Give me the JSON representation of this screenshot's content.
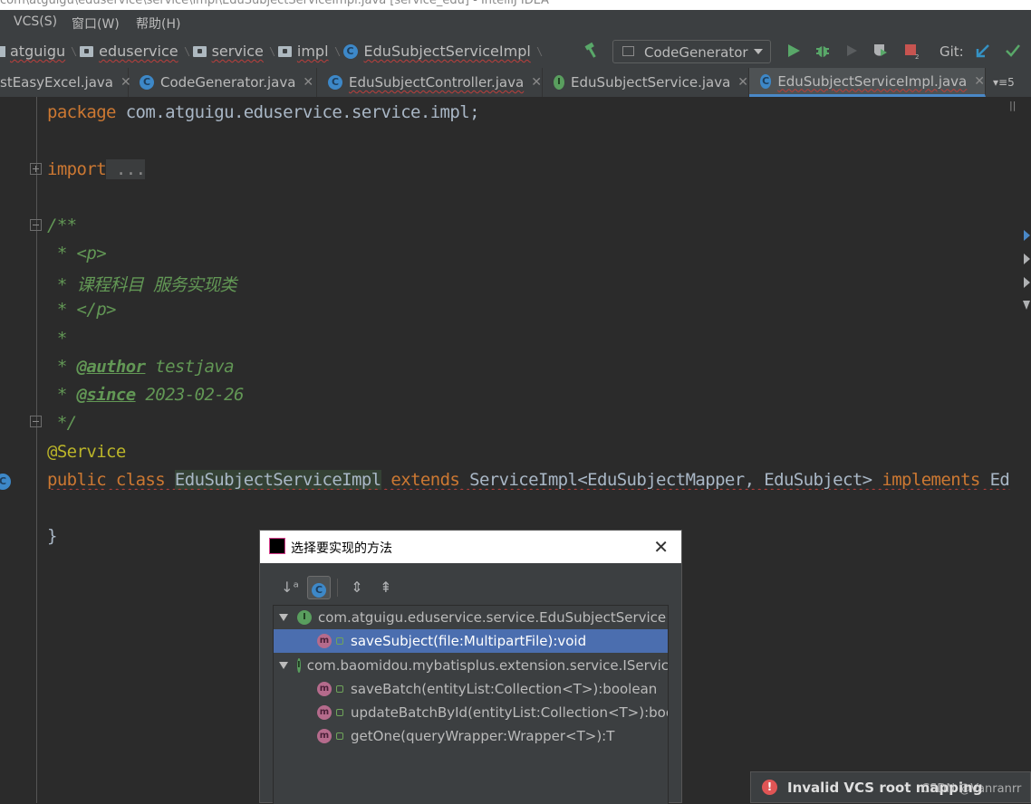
{
  "window": {
    "title": "com\\atguigu\\eduservice\\service\\impl\\EduSubjectServiceImpl.java [service_edu] - IntelliJ IDEA"
  },
  "menu": {
    "vcs": "VCS(S)",
    "window": "窗口(W)",
    "help": "帮助(H)"
  },
  "breadcrumb": [
    "atguigu",
    "eduservice",
    "service",
    "impl",
    "EduSubjectServiceImpl"
  ],
  "toolbar": {
    "run_config": "CodeGenerator",
    "git_label": "Git:"
  },
  "tabs": [
    {
      "label": "stEasyExcel.java"
    },
    {
      "label": "CodeGenerator.java"
    },
    {
      "label": "EduSubjectController.java"
    },
    {
      "label": "EduSubjectService.java"
    },
    {
      "label": "EduSubjectServiceImpl.java",
      "active": true
    }
  ],
  "tab_overflow": "5",
  "code": {
    "pkg_kw": "package",
    "pkg_name": " com.atguigu.eduservice.service.impl;",
    "import_kw": "import",
    "import_fold": " ...",
    "doc_open": "/**",
    "doc_p_open": " * <p>",
    "doc_desc": " * 课程科目 服务实现类",
    "doc_p_close": " * </p>",
    "doc_blank": " *",
    "doc_author_prefix": " * ",
    "doc_author_tag": "@author",
    "doc_author_val": " testjava",
    "doc_since_prefix": " * ",
    "doc_since_tag": "@since",
    "doc_since_val": " 2023-02-26",
    "doc_close": " */",
    "annotation": "@Service",
    "cls_public": "public",
    "cls_class": " class ",
    "cls_name": "EduSubjectServiceImpl",
    "cls_extends": " extends ",
    "cls_super": "ServiceImpl<EduSubjectMapper, EduSubject> ",
    "cls_implements": "implements",
    "cls_tail": " Ed",
    "closing_brace": "}"
  },
  "dialog": {
    "title": "选择要实现的方法",
    "groups": [
      {
        "name": "com.atguigu.eduservice.service.EduSubjectService",
        "methods": [
          {
            "label": "saveSubject(file:MultipartFile):void",
            "selected": true
          }
        ]
      },
      {
        "name": "com.baomidou.mybatisplus.extension.service.IService",
        "methods": [
          {
            "label": "saveBatch(entityList:Collection<T>):boolean"
          },
          {
            "label": "updateBatchById(entityList:Collection<T>):boolean"
          },
          {
            "label": "getOne(queryWrapper:Wrapper<T>):T"
          }
        ]
      }
    ]
  },
  "notification": {
    "message": "Invalid VCS root mapping",
    "watermark": "CSDN @Vanranrr"
  },
  "colors": {
    "keyword": "#cc7832",
    "doc": "#629755",
    "annotation": "#bbb529",
    "selection": "#4b6eaf",
    "accent": "#4a88c7"
  }
}
